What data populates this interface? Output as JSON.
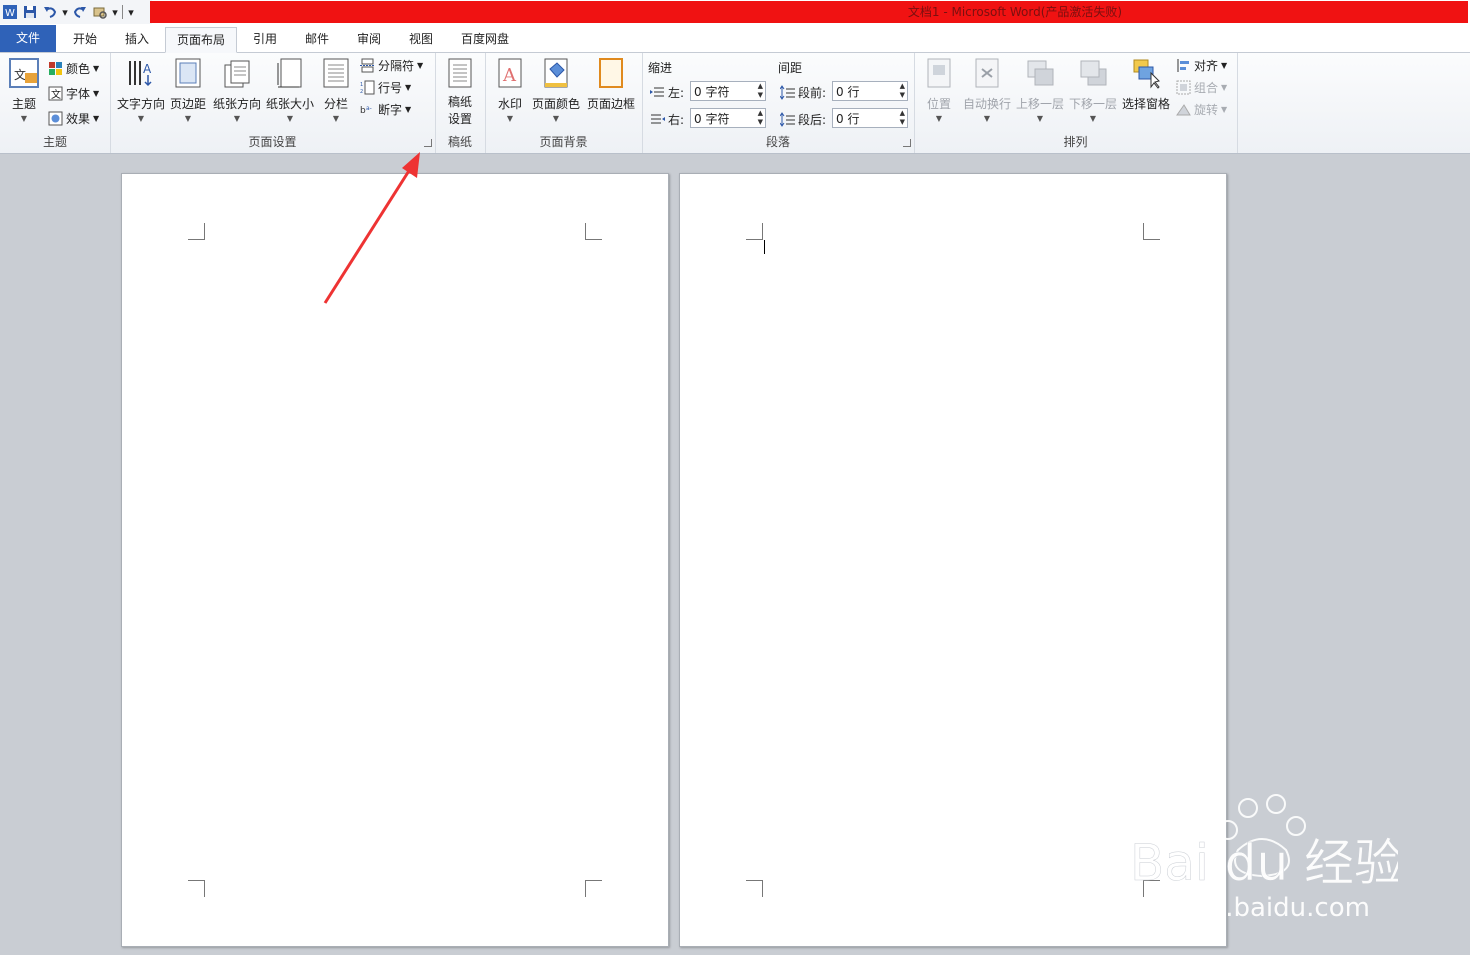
{
  "window": {
    "title": "文档1 - Microsoft Word(产品激活失败)"
  },
  "tabs": [
    {
      "label": "文件"
    },
    {
      "label": "开始"
    },
    {
      "label": "插入"
    },
    {
      "label": "页面布局"
    },
    {
      "label": "引用"
    },
    {
      "label": "邮件"
    },
    {
      "label": "审阅"
    },
    {
      "label": "视图"
    },
    {
      "label": "百度网盘"
    }
  ],
  "ribbon": {
    "theme_group": {
      "label": "主题",
      "theme_btn": "主题",
      "colors": "颜色",
      "fonts": "字体",
      "effects": "效果"
    },
    "page_setup": {
      "label": "页面设置",
      "text_direction": "文字方向",
      "margins": "页边距",
      "orientation": "纸张方向",
      "size": "纸张大小",
      "columns": "分栏",
      "breaks": "分隔符",
      "line_numbers": "行号",
      "hyphenation": "断字"
    },
    "manuscript": {
      "label": "稿纸",
      "btn_line1": "稿纸",
      "btn_line2": "设置"
    },
    "background": {
      "label": "页面背景",
      "watermark": "水印",
      "page_color": "页面颜色",
      "page_borders": "页面边框"
    },
    "paragraph": {
      "label": "段落",
      "indent_title": "缩进",
      "spacing_title": "间距",
      "left_label": "左:",
      "left_value": "0 字符",
      "right_label": "右:",
      "right_value": "0 字符",
      "before_label": "段前:",
      "before_value": "0 行",
      "after_label": "段后:",
      "after_value": "0 行"
    },
    "arrange": {
      "label": "排列",
      "position": "位置",
      "wrap": "自动换行",
      "forward": "上移一层",
      "backward": "下移一层",
      "selection_pane": "选择窗格",
      "align": "对齐",
      "group": "组合",
      "rotate": "旋转"
    }
  },
  "watermark": {
    "brand": "Bai du 经验",
    "url": "jingyan.baidu.com"
  },
  "colors": {
    "file_tab": "#2f62b8",
    "title_bar": "#f01212",
    "annotation_arrow": "#ee3333"
  }
}
